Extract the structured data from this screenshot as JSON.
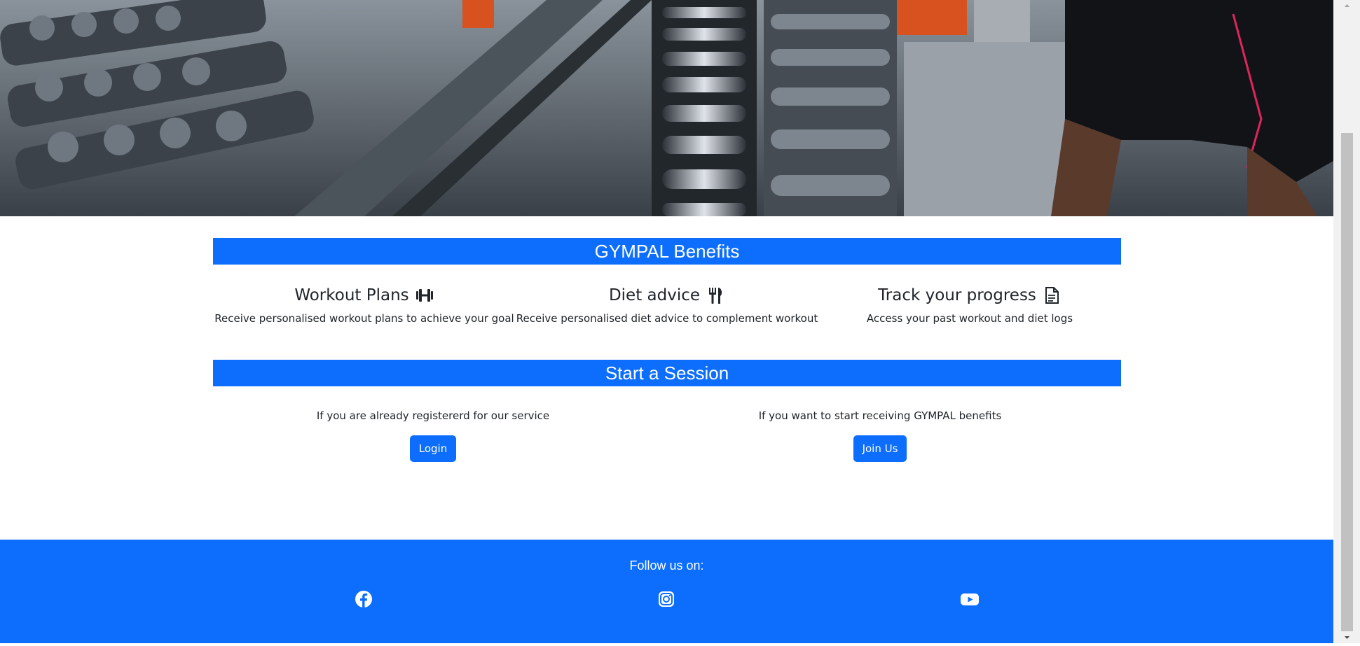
{
  "benefits_section": {
    "heading": "GYMPAL Benefits",
    "items": [
      {
        "title": "Workout Plans",
        "icon": "dumbbell-icon",
        "description": "Receive personalised workout plans to achieve your goal"
      },
      {
        "title": "Diet advice",
        "icon": "fork-knife-icon",
        "description": "Receive personalised diet advice to complement workout"
      },
      {
        "title": "Track your progress",
        "icon": "document-icon",
        "description": "Access your past workout and diet logs"
      }
    ]
  },
  "session_section": {
    "heading": "Start a Session",
    "login_text": "If you are already registererd for our service",
    "login_button": "Login",
    "join_text": "If you want to start receiving GYMPAL benefits",
    "join_button": "Join Us"
  },
  "footer": {
    "follow_text": "Follow us on:",
    "social": [
      "facebook-icon",
      "instagram-icon",
      "youtube-icon"
    ]
  },
  "colors": {
    "primary": "#0d6efd",
    "text": "#212529",
    "white": "#ffffff"
  }
}
